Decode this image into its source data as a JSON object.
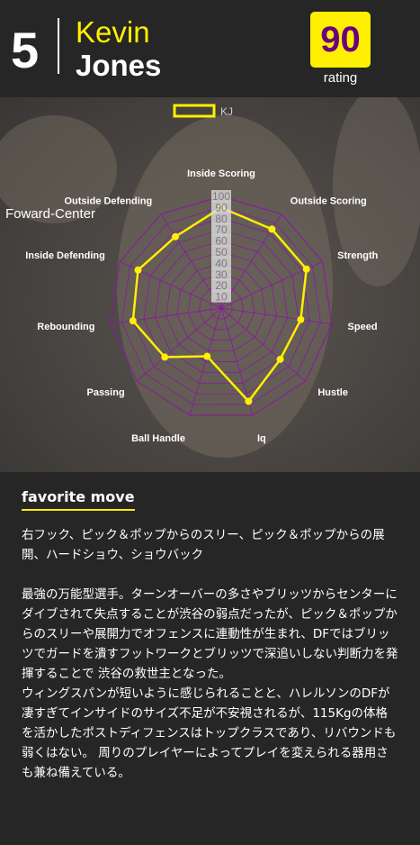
{
  "player": {
    "number": "5",
    "first_name": "Kevin",
    "last_name": "Jones",
    "rating": "90",
    "rating_label": "rating",
    "position": "Foward-Center"
  },
  "colors": {
    "accent": "#ffef00",
    "rating_text": "#6a0080",
    "grid": "#8a1aa0",
    "background": "#262626"
  },
  "chart_data": {
    "type": "radar",
    "legend": [
      "KJ"
    ],
    "legend_placement": "top-center",
    "axes": [
      "Inside Scoring",
      "Outside Scoring",
      "Strength",
      "Speed",
      "Hustle",
      "Iq",
      "Ball Handle",
      "Passing",
      "Rebounding",
      "Inside Defending",
      "Outside Defending"
    ],
    "ticks": [
      "100",
      "90",
      "80",
      "70",
      "60",
      "50",
      "40",
      "30",
      "20",
      "10"
    ],
    "range": [
      0,
      100
    ],
    "series": [
      {
        "name": "KJ",
        "values": [
          90,
          84,
          84,
          72,
          70,
          87,
          45,
          67,
          80,
          82,
          76
        ]
      }
    ]
  },
  "favorite_move": {
    "title": "favorite move",
    "text": "右フック、ピック＆ポップからのスリー、ピック＆ポップからの展開、ハードショウ、ショウバック"
  },
  "bio": {
    "text": "最強の万能型選手。ターンオーバーの多さやブリッツからセンターにダイブされて失点することが渋谷の弱点だったが、ピック＆ポップからのスリーや展開力でオフェンスに連動性が生まれ、DFではブリッツでガードを潰すフットワークとブリッツで深追いしない判断力を発揮することで 渋谷の救世主となった。\nウィングスパンが短いように感じられることと、ハレルソンのDFが凄すぎてインサイドのサイズ不足が不安視されるが、115Kgの体格を活かしたポストディフェンスはトップクラスであり、リバウンドも弱くはない。 周りのプレイヤーによってプレイを変えられる器用さも兼ね備えている。"
  }
}
